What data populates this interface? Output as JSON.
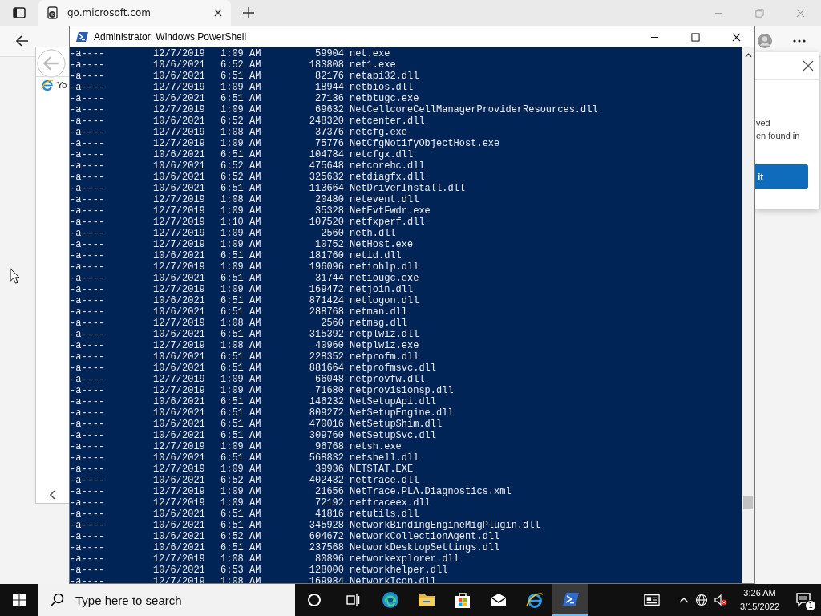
{
  "browser": {
    "tab_title": "go.microsoft.com",
    "embedded_page": {
      "link_text": "Yo"
    },
    "popup": {
      "lines": [
        "ved",
        "en found in"
      ],
      "button": "it"
    }
  },
  "console_window": {
    "title": "Administrator: Windows PowerShell",
    "rows": [
      {
        "mode": "-a----",
        "date": "12/7/2019",
        "time": "1:09 AM",
        "size": "59904",
        "name": "net.exe"
      },
      {
        "mode": "-a----",
        "date": "10/6/2021",
        "time": "6:52 AM",
        "size": "183808",
        "name": "net1.exe"
      },
      {
        "mode": "-a----",
        "date": "10/6/2021",
        "time": "6:51 AM",
        "size": "82176",
        "name": "netapi32.dll"
      },
      {
        "mode": "-a----",
        "date": "12/7/2019",
        "time": "1:09 AM",
        "size": "18944",
        "name": "netbios.dll"
      },
      {
        "mode": "-a----",
        "date": "10/6/2021",
        "time": "6:51 AM",
        "size": "27136",
        "name": "netbtugc.exe"
      },
      {
        "mode": "-a----",
        "date": "12/7/2019",
        "time": "1:09 AM",
        "size": "69632",
        "name": "NetCellcoreCellManagerProviderResources.dll"
      },
      {
        "mode": "-a----",
        "date": "10/6/2021",
        "time": "6:52 AM",
        "size": "248320",
        "name": "netcenter.dll"
      },
      {
        "mode": "-a----",
        "date": "12/7/2019",
        "time": "1:08 AM",
        "size": "37376",
        "name": "netcfg.exe"
      },
      {
        "mode": "-a----",
        "date": "12/7/2019",
        "time": "1:09 AM",
        "size": "75776",
        "name": "NetCfgNotifyObjectHost.exe"
      },
      {
        "mode": "-a----",
        "date": "10/6/2021",
        "time": "6:51 AM",
        "size": "104784",
        "name": "netcfgx.dll"
      },
      {
        "mode": "-a----",
        "date": "10/6/2021",
        "time": "6:52 AM",
        "size": "475648",
        "name": "netcorehc.dll"
      },
      {
        "mode": "-a----",
        "date": "10/6/2021",
        "time": "6:52 AM",
        "size": "325632",
        "name": "netdiagfx.dll"
      },
      {
        "mode": "-a----",
        "date": "10/6/2021",
        "time": "6:51 AM",
        "size": "113664",
        "name": "NetDriverInstall.dll"
      },
      {
        "mode": "-a----",
        "date": "12/7/2019",
        "time": "1:08 AM",
        "size": "20480",
        "name": "netevent.dll"
      },
      {
        "mode": "-a----",
        "date": "12/7/2019",
        "time": "1:09 AM",
        "size": "35328",
        "name": "NetEvtFwdr.exe"
      },
      {
        "mode": "-a----",
        "date": "12/7/2019",
        "time": "1:10 AM",
        "size": "107520",
        "name": "netfxperf.dll"
      },
      {
        "mode": "-a----",
        "date": "12/7/2019",
        "time": "1:09 AM",
        "size": "2560",
        "name": "neth.dll"
      },
      {
        "mode": "-a----",
        "date": "12/7/2019",
        "time": "1:09 AM",
        "size": "10752",
        "name": "NetHost.exe"
      },
      {
        "mode": "-a----",
        "date": "10/6/2021",
        "time": "6:51 AM",
        "size": "181760",
        "name": "netid.dll"
      },
      {
        "mode": "-a----",
        "date": "12/7/2019",
        "time": "1:09 AM",
        "size": "196096",
        "name": "netiohlp.dll"
      },
      {
        "mode": "-a----",
        "date": "10/6/2021",
        "time": "6:51 AM",
        "size": "31744",
        "name": "netiougc.exe"
      },
      {
        "mode": "-a----",
        "date": "12/7/2019",
        "time": "1:09 AM",
        "size": "169472",
        "name": "netjoin.dll"
      },
      {
        "mode": "-a----",
        "date": "10/6/2021",
        "time": "6:51 AM",
        "size": "871424",
        "name": "netlogon.dll"
      },
      {
        "mode": "-a----",
        "date": "10/6/2021",
        "time": "6:51 AM",
        "size": "288768",
        "name": "netman.dll"
      },
      {
        "mode": "-a----",
        "date": "12/7/2019",
        "time": "1:08 AM",
        "size": "2560",
        "name": "netmsg.dll"
      },
      {
        "mode": "-a----",
        "date": "10/6/2021",
        "time": "6:51 AM",
        "size": "315392",
        "name": "netplwiz.dll"
      },
      {
        "mode": "-a----",
        "date": "12/7/2019",
        "time": "1:08 AM",
        "size": "40960",
        "name": "Netplwiz.exe"
      },
      {
        "mode": "-a----",
        "date": "10/6/2021",
        "time": "6:51 AM",
        "size": "228352",
        "name": "netprofm.dll"
      },
      {
        "mode": "-a----",
        "date": "10/6/2021",
        "time": "6:51 AM",
        "size": "881664",
        "name": "netprofmsvc.dll"
      },
      {
        "mode": "-a----",
        "date": "12/7/2019",
        "time": "1:09 AM",
        "size": "66048",
        "name": "netprovfw.dll"
      },
      {
        "mode": "-a----",
        "date": "12/7/2019",
        "time": "1:09 AM",
        "size": "71680",
        "name": "netprovisionsp.dll"
      },
      {
        "mode": "-a----",
        "date": "10/6/2021",
        "time": "6:51 AM",
        "size": "146232",
        "name": "NetSetupApi.dll"
      },
      {
        "mode": "-a----",
        "date": "10/6/2021",
        "time": "6:51 AM",
        "size": "809272",
        "name": "NetSetupEngine.dll"
      },
      {
        "mode": "-a----",
        "date": "10/6/2021",
        "time": "6:51 AM",
        "size": "470016",
        "name": "NetSetupShim.dll"
      },
      {
        "mode": "-a----",
        "date": "10/6/2021",
        "time": "6:51 AM",
        "size": "309760",
        "name": "NetSetupSvc.dll"
      },
      {
        "mode": "-a----",
        "date": "12/7/2019",
        "time": "1:09 AM",
        "size": "96768",
        "name": "netsh.exe"
      },
      {
        "mode": "-a----",
        "date": "10/6/2021",
        "time": "6:51 AM",
        "size": "568832",
        "name": "netshell.dll"
      },
      {
        "mode": "-a----",
        "date": "12/7/2019",
        "time": "1:09 AM",
        "size": "39936",
        "name": "NETSTAT.EXE"
      },
      {
        "mode": "-a----",
        "date": "10/6/2021",
        "time": "6:52 AM",
        "size": "402432",
        "name": "nettrace.dll"
      },
      {
        "mode": "-a----",
        "date": "12/7/2019",
        "time": "1:09 AM",
        "size": "21656",
        "name": "NetTrace.PLA.Diagnostics.xml"
      },
      {
        "mode": "-a----",
        "date": "12/7/2019",
        "time": "1:09 AM",
        "size": "72192",
        "name": "nettraceex.dll"
      },
      {
        "mode": "-a----",
        "date": "10/6/2021",
        "time": "6:51 AM",
        "size": "41816",
        "name": "netutils.dll"
      },
      {
        "mode": "-a----",
        "date": "10/6/2021",
        "time": "6:51 AM",
        "size": "345928",
        "name": "NetworkBindingEngineMigPlugin.dll"
      },
      {
        "mode": "-a----",
        "date": "10/6/2021",
        "time": "6:52 AM",
        "size": "604672",
        "name": "NetworkCollectionAgent.dll"
      },
      {
        "mode": "-a----",
        "date": "10/6/2021",
        "time": "6:51 AM",
        "size": "237568",
        "name": "NetworkDesktopSettings.dll"
      },
      {
        "mode": "-a----",
        "date": "12/7/2019",
        "time": "1:08 AM",
        "size": "80896",
        "name": "networkexplorer.dll"
      },
      {
        "mode": "-a----",
        "date": "10/6/2021",
        "time": "6:53 AM",
        "size": "128000",
        "name": "networkhelper.dll"
      },
      {
        "mode": "-a----",
        "date": "12/7/2019",
        "time": "1:08 AM",
        "size": "169984",
        "name": "NetworkIcon.dll"
      }
    ]
  },
  "taskbar": {
    "search_placeholder": "Type here to search",
    "apps": [
      {
        "kind": "edge",
        "selected": false
      },
      {
        "kind": "explorer",
        "selected": false
      },
      {
        "kind": "store",
        "selected": false
      },
      {
        "kind": "mail",
        "selected": false
      },
      {
        "kind": "ie",
        "selected": false
      },
      {
        "kind": "powershell",
        "selected": true
      }
    ],
    "time": "3:26 AM",
    "date": "3/15/2022",
    "notification_count": "1"
  }
}
